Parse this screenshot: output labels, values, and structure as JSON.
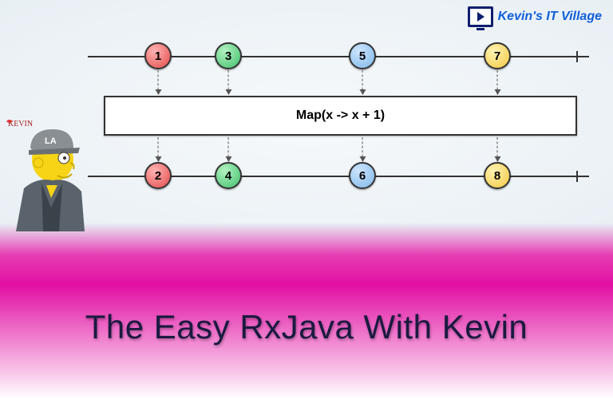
{
  "brand": {
    "name": "Kevin's IT Village"
  },
  "main_title": "The Easy RxJava With Kevin",
  "operator_label": "Map(x -> x + 1)",
  "chart_data": {
    "type": "marble-diagram",
    "operator": "Map(x -> x + 1)",
    "input_stream": [
      {
        "value": "1",
        "color": "#e24a4a",
        "pos": 0.14
      },
      {
        "value": "3",
        "color": "#3fbf6b",
        "pos": 0.28
      },
      {
        "value": "5",
        "color": "#7fb8e8",
        "pos": 0.55
      },
      {
        "value": "7",
        "color": "#f2c83f",
        "pos": 0.82
      }
    ],
    "output_stream": [
      {
        "value": "2",
        "color": "#e24a4a",
        "pos": 0.14
      },
      {
        "value": "4",
        "color": "#3fbf6b",
        "pos": 0.28
      },
      {
        "value": "6",
        "color": "#7fb8e8",
        "pos": 0.55
      },
      {
        "value": "8",
        "color": "#f2c83f",
        "pos": 0.82
      }
    ]
  },
  "marbles": {
    "i1": "1",
    "i2": "3",
    "i3": "5",
    "i4": "7",
    "o1": "2",
    "o2": "4",
    "o3": "6",
    "o4": "8"
  },
  "avatar": {
    "name_label": "KEVIN",
    "cap_text": "LA"
  }
}
